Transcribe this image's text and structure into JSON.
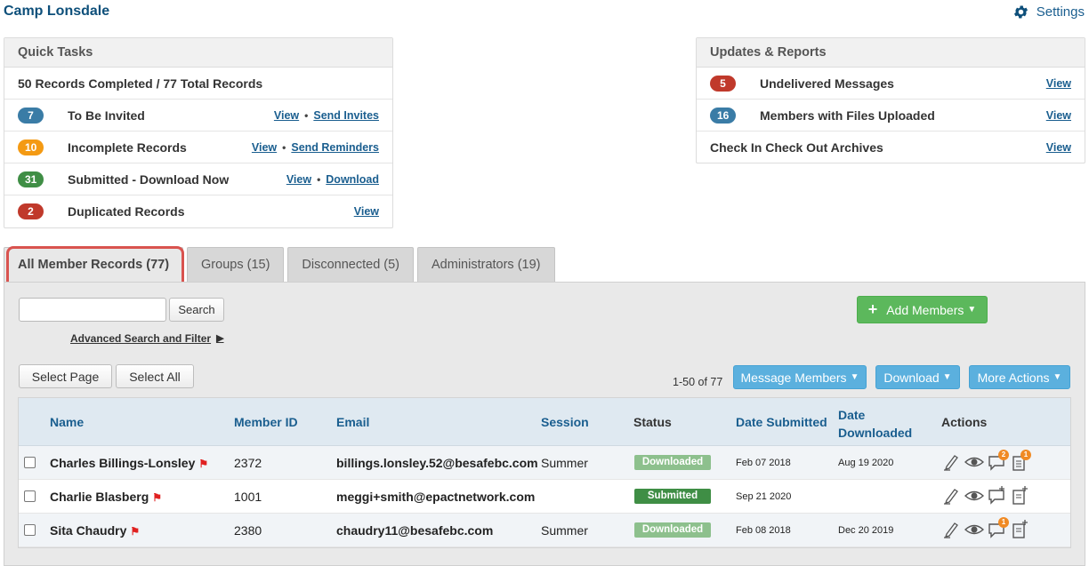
{
  "org_title": "Camp Lonsdale",
  "settings_label": "Settings",
  "quick_tasks": {
    "title": "Quick Tasks",
    "summary": "50 Records Completed / 77 Total Records",
    "rows": [
      {
        "count": "7",
        "color": "#3a7ca6",
        "label": "To Be Invited",
        "links": [
          "View",
          "Send Invites"
        ]
      },
      {
        "count": "10",
        "color": "#f49a13",
        "label": "Incomplete Records",
        "links": [
          "View",
          "Send Reminders"
        ]
      },
      {
        "count": "31",
        "color": "#3f8e45",
        "label": "Submitted - Download Now",
        "links": [
          "View",
          "Download"
        ]
      },
      {
        "count": "2",
        "color": "#c0392b",
        "label": "Duplicated Records",
        "links": [
          "View"
        ]
      }
    ]
  },
  "updates": {
    "title": "Updates & Reports",
    "rows": [
      {
        "count": "5",
        "color": "#c0392b",
        "label": "Undelivered Messages",
        "link": "View"
      },
      {
        "count": "16",
        "color": "#3a7ca6",
        "label": "Members with Files Uploaded",
        "link": "View"
      },
      {
        "count": "",
        "label": "Check In Check Out Archives",
        "link": "View"
      }
    ]
  },
  "tabs": [
    "All Member Records (77)",
    "Groups (15)",
    "Disconnected (5)",
    "Administrators (19)"
  ],
  "toolbar": {
    "search_placeholder": "",
    "search_button": "Search",
    "advanced_link": "Advanced Search and Filter",
    "advanced_arrow": "▶",
    "add_members": "Add Members",
    "select_page": "Select Page",
    "select_all": "Select All",
    "count_text": "1-50 of 77",
    "message_members": "Message Members",
    "download": "Download",
    "more_actions": "More Actions"
  },
  "table": {
    "headers": {
      "name": "Name",
      "member_id": "Member ID",
      "email": "Email",
      "session": "Session",
      "status": "Status",
      "date_submitted": "Date Submitted",
      "date_downloaded_1": "Date",
      "date_downloaded_2": "Downloaded",
      "actions": "Actions"
    },
    "rows": [
      {
        "name": "Charles Billings-Lonsley",
        "member_id": "2372",
        "email": "billings.lonsley.52@besafebc.com",
        "session": "Summer",
        "status": "Downloaded",
        "date_submitted": "Feb 07 2018",
        "date_downloaded": "Aug 19 2020",
        "msg_count": "2",
        "file_count": "1"
      },
      {
        "name": "Charlie Blasberg",
        "member_id": "1001",
        "email": "meggi+smith@epactnetwork.com",
        "session": "",
        "status": "Submitted",
        "date_submitted": "Sep 21 2020",
        "date_downloaded": "",
        "msg_count": "",
        "file_count": ""
      },
      {
        "name": "Sita Chaudry",
        "member_id": "2380",
        "email": "chaudry11@besafebc.com",
        "session": "Summer",
        "status": "Downloaded",
        "date_submitted": "Feb 08 2018",
        "date_downloaded": "Dec 20 2019",
        "msg_count": "1",
        "file_count": ""
      }
    ]
  },
  "colors": {
    "brand": "#0d4f7a",
    "link": "#1a5e8f",
    "highlight": "#d9534f",
    "add_button": "#5cb85c",
    "action_button": "#5bb0de"
  }
}
